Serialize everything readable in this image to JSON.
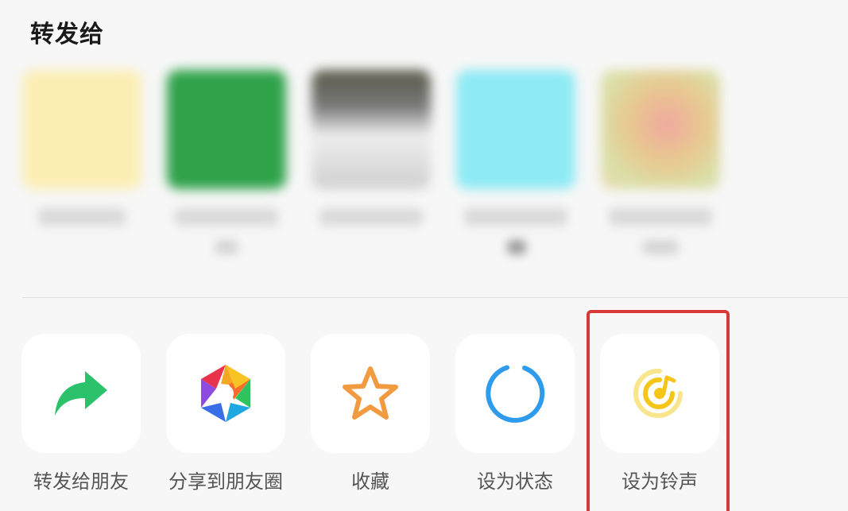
{
  "sheet": {
    "title": "转发给"
  },
  "contacts": [
    {
      "avatar_color": "#fbeeb4"
    },
    {
      "avatar_color": "#2fa24a"
    },
    {
      "avatar_color": "#d9d9d9"
    },
    {
      "avatar_color": "#8eeaf5"
    },
    {
      "avatar_color": "#ecd8b0"
    }
  ],
  "actions": [
    {
      "label": "转发给朋友",
      "icon": "forward-arrow-icon",
      "color": "#2bc26b"
    },
    {
      "label": "分享到朋友圈",
      "icon": "moments-aperture-icon",
      "color": "#f5a623"
    },
    {
      "label": "收藏",
      "icon": "star-icon",
      "color": "#f29a3f"
    },
    {
      "label": "设为状态",
      "icon": "status-ring-icon",
      "color": "#2f9bed"
    },
    {
      "label": "设为铃声",
      "icon": "ringtone-icon",
      "color": "#f5c518"
    }
  ],
  "highlight_color": "#d93838"
}
